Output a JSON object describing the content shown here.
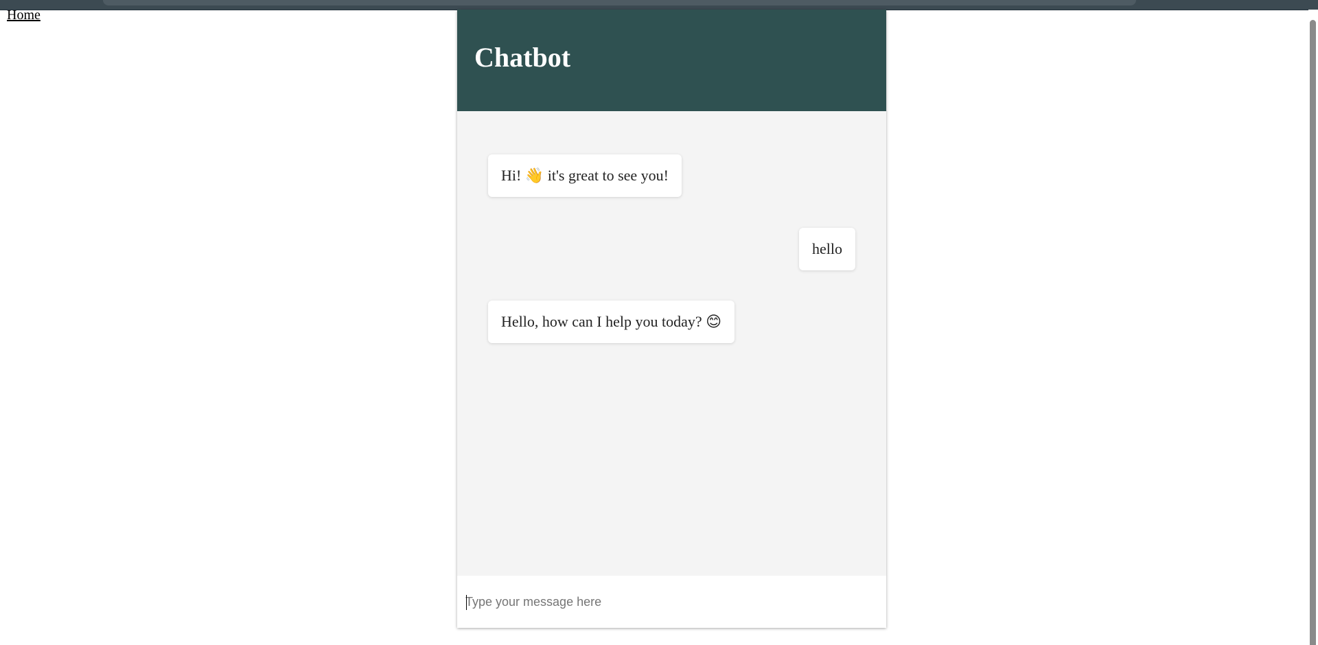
{
  "nav": {
    "home_label": "Home"
  },
  "chat": {
    "title": "Chatbot",
    "messages": [
      {
        "sender": "bot",
        "text_before": "Hi! ",
        "emoji": "👋",
        "emoji_name": "waving-hand-icon",
        "text_after": " it's great to see you!"
      },
      {
        "sender": "user",
        "text": "hello"
      },
      {
        "sender": "bot",
        "text_before": "Hello, how can I help you today? ",
        "emoji": "😊",
        "emoji_name": "smiling-face-icon",
        "text_after": ""
      }
    ],
    "input": {
      "placeholder": "Type your message here",
      "value": ""
    }
  },
  "colors": {
    "header_bg": "#2f5151",
    "panel_bg": "#f4f4f4",
    "bubble_bg": "#ffffff",
    "title_color": "#ffffff"
  }
}
